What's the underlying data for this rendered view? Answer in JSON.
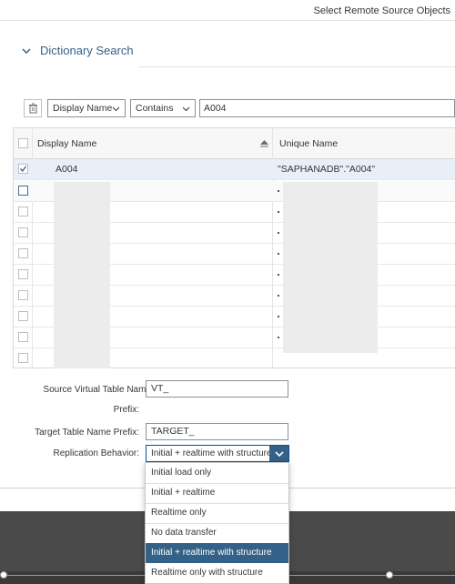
{
  "window": {
    "title": "Select Remote Source Objects"
  },
  "section": {
    "title": "Dictionary Search"
  },
  "filter": {
    "field": "Display Name",
    "operator": "Contains",
    "value": "A004"
  },
  "table": {
    "headers": {
      "display_name": "Display Name",
      "unique_name": "Unique Name"
    },
    "rows": [
      {
        "display_name": "A004",
        "unique_name": "\"SAPHANADB\".\"A004\"",
        "checked": true
      }
    ]
  },
  "form": {
    "source_prefix_label": "Source Virtual Table Name",
    "source_prefix_label2": "Prefix:",
    "source_prefix_value": "VT_",
    "target_prefix_label": "Target Table Name Prefix:",
    "target_prefix_value": "TARGET_",
    "replication_label": "Replication Behavior:",
    "replication_value": "Initial + realtime with structure"
  },
  "dropdown": {
    "options": [
      "Initial load only",
      "Initial + realtime",
      "Realtime only",
      "No data transfer",
      "Initial + realtime with structure",
      "Realtime only with structure"
    ],
    "selected_index": 4
  },
  "colors": {
    "accent": "#346187",
    "selection": "#e8eff6"
  },
  "icons": [
    "chevron-down-icon",
    "trash-icon",
    "sort-icon",
    "checkbox-icon"
  ]
}
